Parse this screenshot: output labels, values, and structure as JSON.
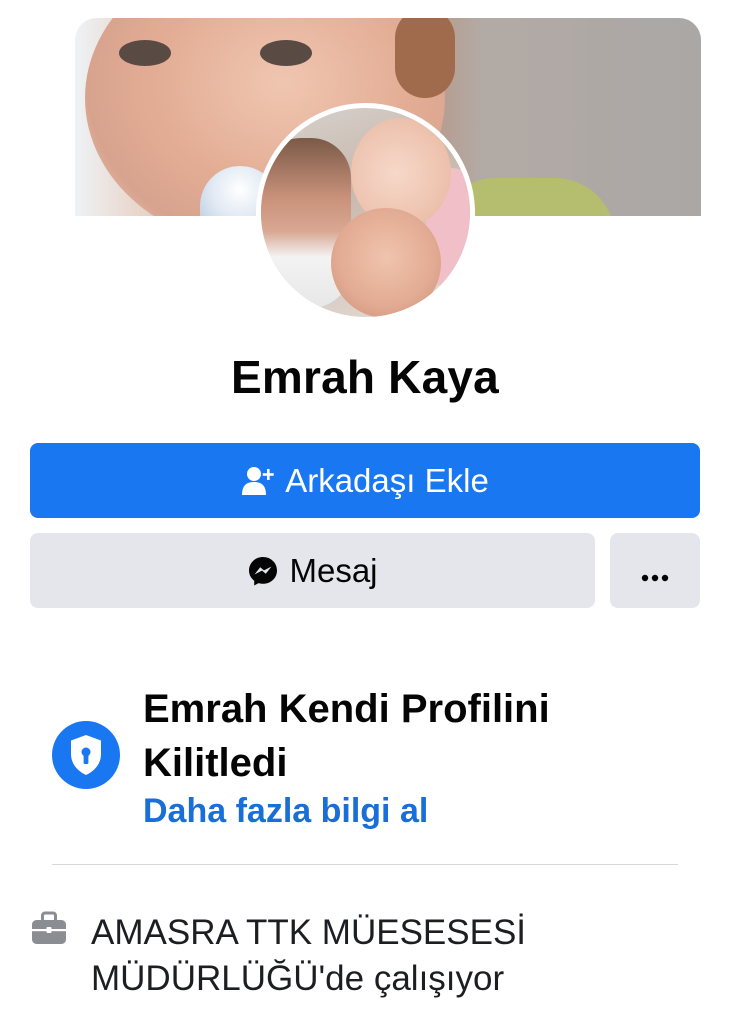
{
  "profile": {
    "name": "Emrah Kaya"
  },
  "actions": {
    "add_friend_label": "Arkadaşı Ekle",
    "message_label": "Mesaj",
    "more_label": "···"
  },
  "lock_notice": {
    "title": "Emrah Kendi Profilini Kilitledi",
    "link": "Daha fazla bilgi al"
  },
  "intro": {
    "work": "AMASRA TTK MÜESESESİ MÜDÜRLÜĞÜ'de çalışıyor"
  },
  "icons": {
    "add_friend": "person-plus-icon",
    "message": "messenger-icon",
    "more": "ellipsis-icon",
    "lock": "shield-lock-icon",
    "work": "briefcase-icon"
  },
  "colors": {
    "primary_blue": "#1a77f2",
    "link_blue": "#1a6ed8",
    "button_grey": "#e4e6eb",
    "text_dark": "#050505"
  }
}
